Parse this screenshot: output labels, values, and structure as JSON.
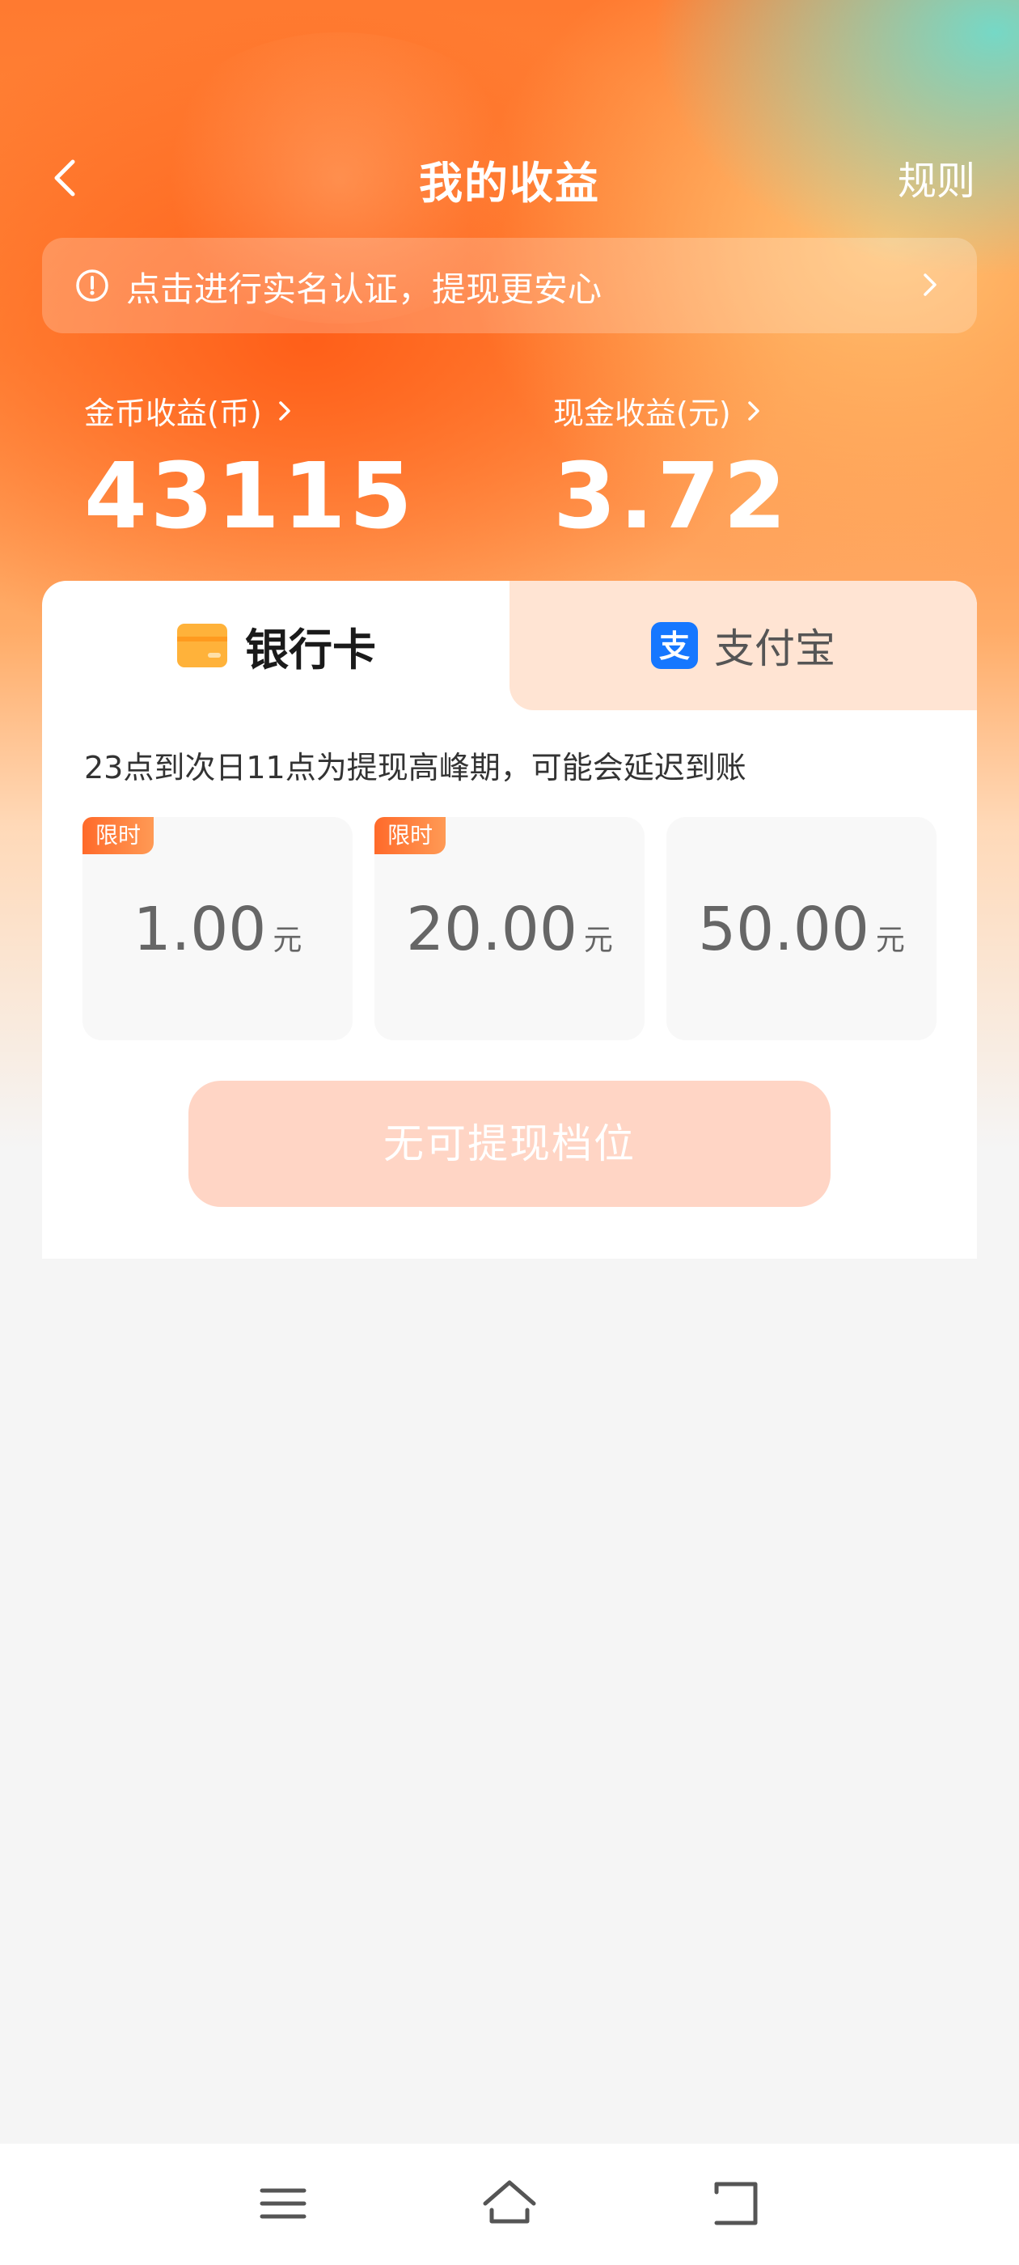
{
  "header": {
    "title": "我的收益",
    "rules_label": "规则"
  },
  "notice": {
    "text": "点击进行实名认证，提现更安心"
  },
  "earnings": {
    "coin_label": "金币收益(币)",
    "coin_value": "43115",
    "cash_label": "现金收益(元)",
    "cash_value": "3.72"
  },
  "tabs": [
    {
      "label": "银行卡",
      "icon": "bank-card-icon",
      "active": true
    },
    {
      "label": "支付宝",
      "icon": "alipay-icon",
      "active": false
    }
  ],
  "tip": "23点到次日11点为提现高峰期，可能会延迟到账",
  "options": [
    {
      "badge": "限时",
      "amount": "1.00",
      "unit": "元"
    },
    {
      "badge": "限时",
      "amount": "20.00",
      "unit": "元"
    },
    {
      "badge": "",
      "amount": "50.00",
      "unit": "元"
    }
  ],
  "submit_label": "无可提现档位",
  "colors": {
    "accent": "#ff6a2a",
    "button_disabled": "#ffd5c5",
    "alipay_blue": "#1677ff"
  }
}
